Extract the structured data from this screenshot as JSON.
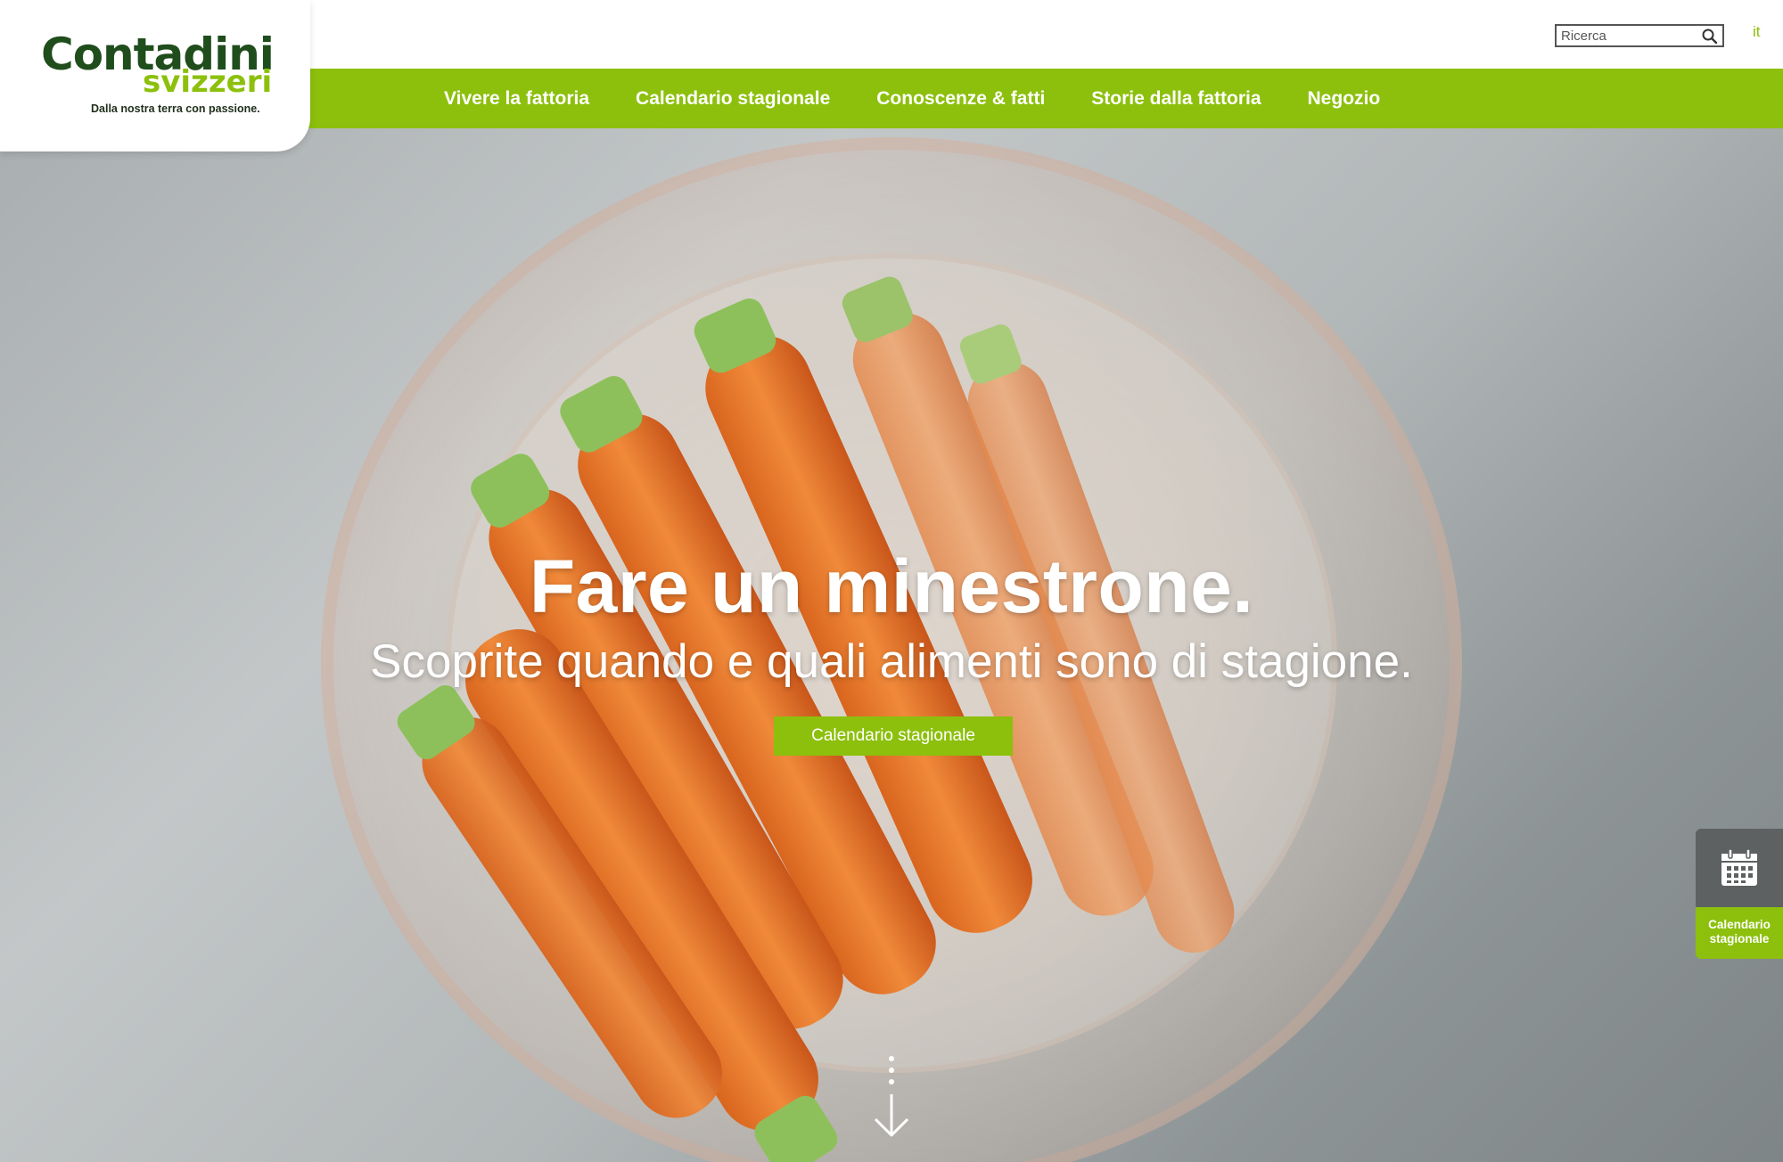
{
  "header": {
    "search": {
      "placeholder": "Ricerca",
      "icon": "search-icon"
    },
    "language": "it"
  },
  "logo": {
    "main": "Contadini",
    "sub": "svizzeri",
    "tagline": "Dalla nostra terra con passione."
  },
  "nav": {
    "items": [
      {
        "label": "Vivere la fattoria"
      },
      {
        "label": "Calendario stagionale"
      },
      {
        "label": "Conoscenze & fatti"
      },
      {
        "label": "Storie dalla fattoria"
      },
      {
        "label": "Negozio"
      }
    ]
  },
  "hero": {
    "title": "Fare un minestrone.",
    "subtitle": "Scoprite quando e quali alimenti sono di stagione.",
    "button": "Calendario stagionale",
    "scroll_icon": "scroll-down-arrow-icon"
  },
  "side_widget": {
    "icon": "calendar-icon",
    "label": "Calendario stagionale"
  },
  "colors": {
    "brand_green": "#8cc00c",
    "logo_dark_green": "#1f4d1c",
    "widget_gray": "#5e6161"
  }
}
